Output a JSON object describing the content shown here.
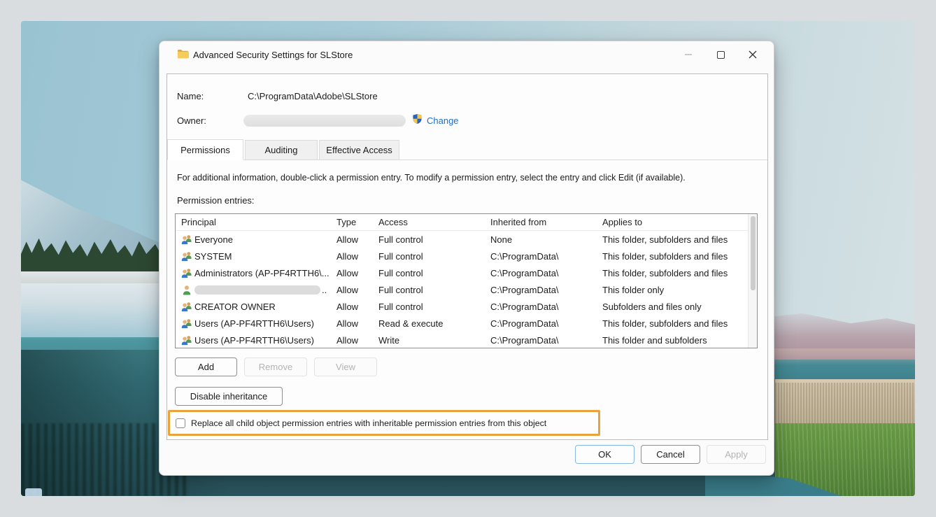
{
  "window": {
    "title": "Advanced Security Settings for SLStore"
  },
  "fields": {
    "name_label": "Name:",
    "name_value": "C:\\ProgramData\\Adobe\\SLStore",
    "owner_label": "Owner:",
    "owner_value_redacted": true,
    "change_link": "Change"
  },
  "tabs": [
    {
      "label": "Permissions",
      "active": true
    },
    {
      "label": "Auditing",
      "active": false
    },
    {
      "label": "Effective Access",
      "active": false
    }
  ],
  "info_text": "For additional information, double-click a permission entry. To modify a permission entry, select the entry and click Edit (if available).",
  "entries_label": "Permission entries:",
  "table": {
    "columns": [
      "Principal",
      "Type",
      "Access",
      "Inherited from",
      "Applies to"
    ],
    "rows": [
      {
        "icon": "group",
        "redacted": false,
        "principal": "Everyone",
        "type": "Allow",
        "access": "Full control",
        "inherited_from": "None",
        "applies_to": "This folder, subfolders and files"
      },
      {
        "icon": "group",
        "redacted": false,
        "principal": "SYSTEM",
        "type": "Allow",
        "access": "Full control",
        "inherited_from": "C:\\ProgramData\\",
        "applies_to": "This folder, subfolders and files"
      },
      {
        "icon": "group",
        "redacted": false,
        "principal": "Administrators (AP-PF4RTTH6\\...",
        "type": "Allow",
        "access": "Full control",
        "inherited_from": "C:\\ProgramData\\",
        "applies_to": "This folder, subfolders and files"
      },
      {
        "icon": "user",
        "redacted": true,
        "principal": "..",
        "type": "Allow",
        "access": "Full control",
        "inherited_from": "C:\\ProgramData\\",
        "applies_to": "This folder only"
      },
      {
        "icon": "group",
        "redacted": false,
        "principal": "CREATOR OWNER",
        "type": "Allow",
        "access": "Full control",
        "inherited_from": "C:\\ProgramData\\",
        "applies_to": "Subfolders and files only"
      },
      {
        "icon": "group",
        "redacted": false,
        "principal": "Users (AP-PF4RTTH6\\Users)",
        "type": "Allow",
        "access": "Read & execute",
        "inherited_from": "C:\\ProgramData\\",
        "applies_to": "This folder, subfolders and files"
      },
      {
        "icon": "group",
        "redacted": false,
        "principal": "Users (AP-PF4RTTH6\\Users)",
        "type": "Allow",
        "access": "Write",
        "inherited_from": "C:\\ProgramData\\",
        "applies_to": "This folder and subfolders"
      }
    ]
  },
  "buttons": {
    "add": "Add",
    "remove": "Remove",
    "view": "View",
    "disable_inheritance": "Disable inheritance",
    "ok": "OK",
    "cancel": "Cancel",
    "apply": "Apply"
  },
  "buttons_state": {
    "remove_disabled": true,
    "view_disabled": true,
    "apply_disabled": true,
    "minimize_disabled": true
  },
  "checkbox": {
    "label": "Replace all child object permission entries with inheritable permission entries from this object",
    "checked": false
  },
  "icons": {
    "titlebar": "folder-icon",
    "owner_row": "uac-shield-icon",
    "group_rows": "group-icon",
    "user_row": "user-icon",
    "window_controls": [
      "minimize-icon",
      "maximize-icon",
      "close-icon"
    ]
  },
  "colors": {
    "highlight_box": "#E8A33C",
    "link": "#1F6FC5",
    "ok_border": "#85B7E4"
  }
}
